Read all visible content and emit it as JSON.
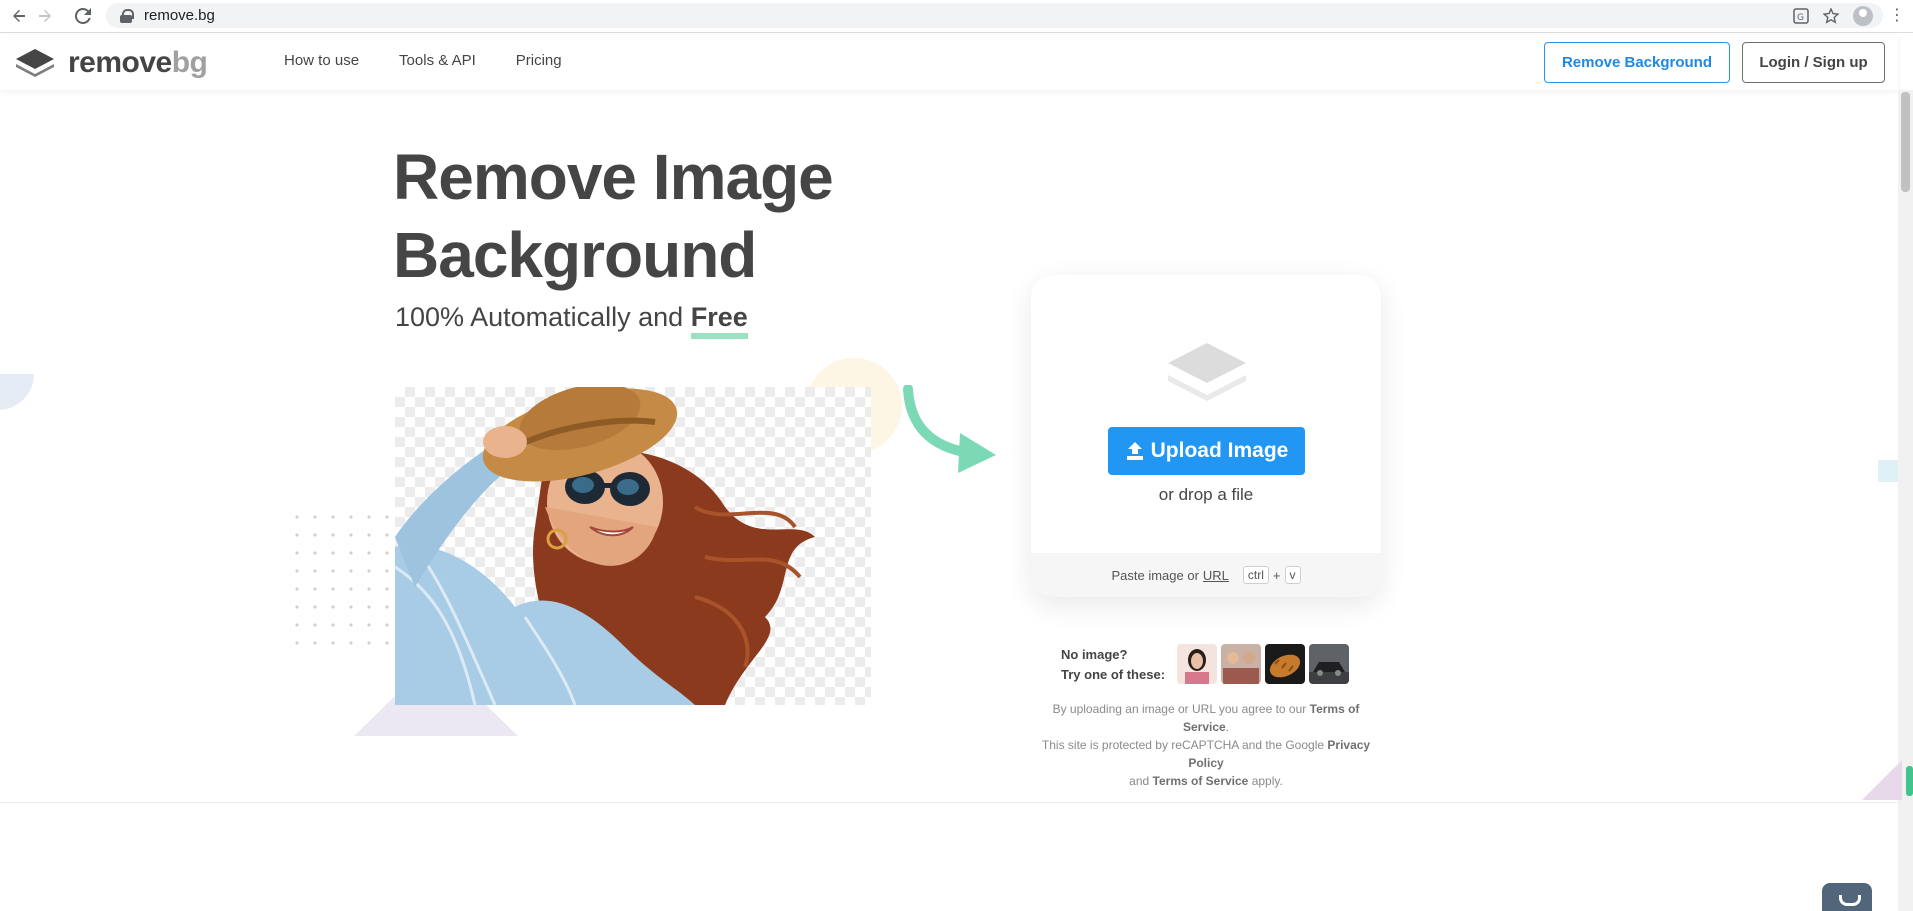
{
  "browser": {
    "url": "remove.bg",
    "back_icon": "arrow-left-icon",
    "forward_icon": "arrow-right-icon",
    "reload_icon": "reload-icon"
  },
  "header": {
    "logo_main": "remove",
    "logo_accent": "bg",
    "nav": [
      "How to use",
      "Tools & API",
      "Pricing"
    ],
    "remove_bg_button": "Remove Background",
    "login_button": "Login / Sign up"
  },
  "hero": {
    "title_line1": "Remove Image",
    "title_line2": "Background",
    "subtitle_prefix": "100% Automatically and",
    "subtitle_emph": "Free"
  },
  "upload": {
    "button_label": "Upload Image",
    "drop_text": "or drop a file",
    "paste_prefix": "Paste image or",
    "paste_url": "URL",
    "kbd_ctrl": "ctrl",
    "kbd_plus": "+",
    "kbd_v": "v"
  },
  "samples": {
    "line1": "No image?",
    "line2": "Try one of these:"
  },
  "legal": {
    "line1_prefix": "By uploading an image or URL you agree to our",
    "terms": "Terms of Service",
    "line2_prefix": "This site is protected by reCAPTCHA and the Google",
    "privacy": "Privacy Policy",
    "line3_and": "and",
    "line3_suffix": "apply."
  },
  "colors": {
    "primary_blue": "#2196f3",
    "text_dark": "#454545",
    "accent_green": "#6fd3a8"
  }
}
